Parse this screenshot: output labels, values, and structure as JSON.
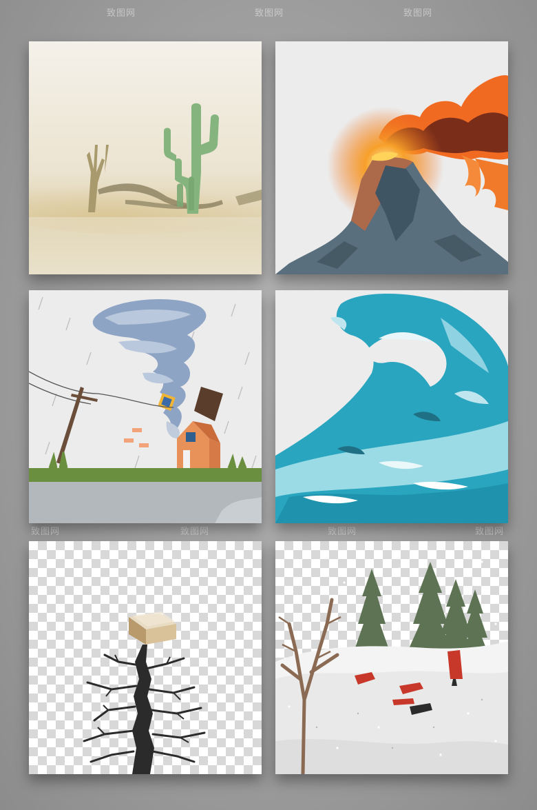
{
  "watermark": {
    "text": "致图网"
  },
  "panels": [
    {
      "id": "drought",
      "icon": "cactus-desert-icon"
    },
    {
      "id": "volcano",
      "icon": "volcano-eruption-icon"
    },
    {
      "id": "tornado",
      "icon": "tornado-house-icon"
    },
    {
      "id": "tsunami",
      "icon": "tsunami-wave-icon"
    },
    {
      "id": "earthquake",
      "icon": "ground-crack-house-icon"
    },
    {
      "id": "blizzard",
      "icon": "snowstorm-trees-icon"
    }
  ],
  "colors": {
    "background": "#a5a5a5",
    "sand": "#d8c9a0",
    "cactus": "#7fb37a",
    "lava": "#f07a1e",
    "mountain": "#546a78",
    "tornado": "#8ea4c4",
    "grass": "#6a8f3f",
    "wave": "#2aa5bf",
    "crack": "#2b2b2b",
    "snow": "#f4f4f4",
    "pine": "#5d7354"
  }
}
